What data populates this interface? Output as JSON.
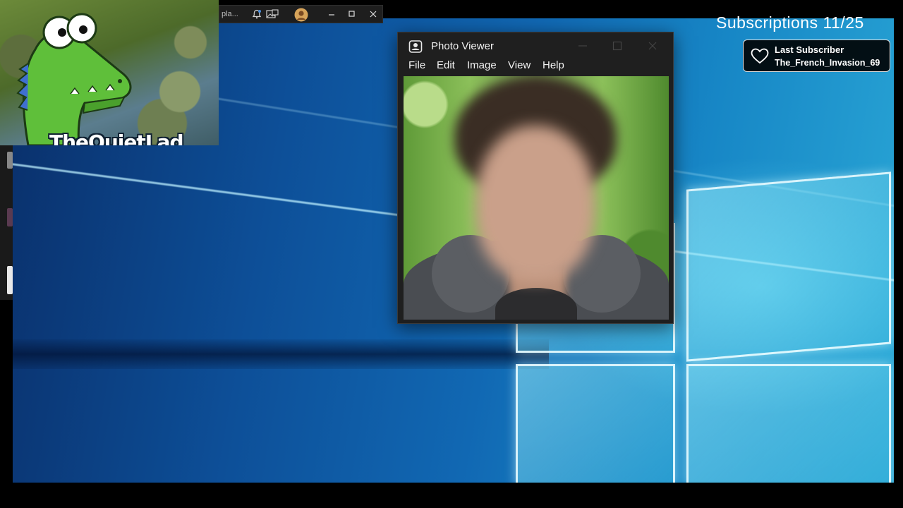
{
  "taskbar": {
    "tab_label": "pla...",
    "icons": [
      "bell-icon",
      "image-icon",
      "avatar",
      "minimize-icon",
      "maximize-icon",
      "close-icon"
    ]
  },
  "webcam": {
    "channel_name": "TheQuietLad"
  },
  "stream_overlay": {
    "subscriptions": "Subscriptions 11/25",
    "last_subscriber_label": "Last Subscriber",
    "last_subscriber_name": "The_French_Invasion_69",
    "icon": "heart-icon"
  },
  "photo_viewer": {
    "title": "Photo Viewer",
    "menu": [
      "File",
      "Edit",
      "Image",
      "View",
      "Help"
    ]
  },
  "colors": {
    "overlay_bg": "#000000",
    "window_bg": "#1f1f1f",
    "desktop_blue": "#1168b3",
    "pane_cyan": "#7fdcf0"
  }
}
